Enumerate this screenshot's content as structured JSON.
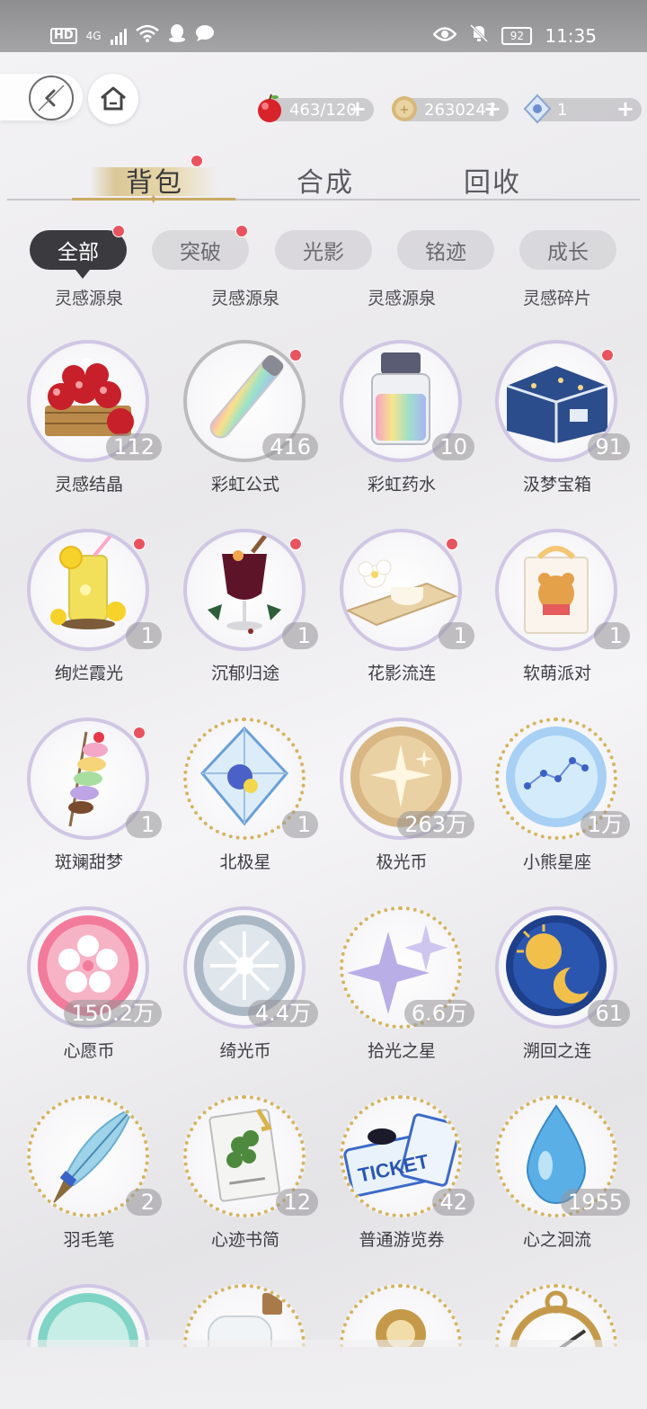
{
  "status": {
    "network": "4G",
    "battery": "92",
    "time": "11:35"
  },
  "resources": [
    {
      "icon": "apple-icon",
      "value": "463/120"
    },
    {
      "icon": "gold-coin-icon",
      "value": "2630247"
    },
    {
      "icon": "diamond-icon",
      "value": "1"
    }
  ],
  "main_tabs": [
    "背包",
    "合成",
    "回收"
  ],
  "sub_tabs": [
    "全部",
    "突破",
    "光影",
    "铭迹",
    "成长"
  ],
  "captions": [
    "灵感源泉",
    "灵感源泉",
    "灵感源泉",
    "灵感碎片"
  ],
  "items": [
    {
      "name": "灵感结晶",
      "count": "112",
      "icon": "apple-basket-icon",
      "ring": "lavender",
      "dot": false
    },
    {
      "name": "彩虹公式",
      "count": "416",
      "icon": "rainbow-tube-icon",
      "ring": "grey",
      "dot": true
    },
    {
      "name": "彩虹药水",
      "count": "10",
      "icon": "rainbow-potion-icon",
      "ring": "lavender",
      "dot": false
    },
    {
      "name": "汲梦宝箱",
      "count": "91",
      "icon": "treasure-box-icon",
      "ring": "lavender",
      "dot": true
    },
    {
      "name": "绚烂霞光",
      "count": "1",
      "icon": "lemonade-icon",
      "ring": "lavender",
      "dot": true
    },
    {
      "name": "沉郁归途",
      "count": "1",
      "icon": "mulled-wine-icon",
      "ring": "lavender",
      "dot": true
    },
    {
      "name": "花影流连",
      "count": "1",
      "icon": "flower-cake-icon",
      "ring": "lavender",
      "dot": true
    },
    {
      "name": "软萌派对",
      "count": "1",
      "icon": "teddy-bag-icon",
      "ring": "lavender",
      "dot": false
    },
    {
      "name": "斑斓甜梦",
      "count": "1",
      "icon": "macaron-skewer-icon",
      "ring": "lavender",
      "dot": true
    },
    {
      "name": "北极星",
      "count": "1",
      "icon": "crystal-icon",
      "ring": "gold",
      "dot": false
    },
    {
      "name": "极光币",
      "count": "263万",
      "icon": "aurora-coin-icon",
      "ring": "lavender",
      "dot": false
    },
    {
      "name": "小熊星座",
      "count": "1万",
      "icon": "constellation-coin-icon",
      "ring": "gold",
      "dot": false
    },
    {
      "name": "心愿币",
      "count": "150.2万",
      "icon": "sakura-coin-icon",
      "ring": "lavender",
      "dot": false
    },
    {
      "name": "绮光币",
      "count": "4.4万",
      "icon": "silver-coin-icon",
      "ring": "lavender",
      "dot": false
    },
    {
      "name": "拾光之星",
      "count": "6.6万",
      "icon": "sparkle-star-icon",
      "ring": "gold",
      "dot": false
    },
    {
      "name": "溯回之连",
      "count": "61",
      "icon": "sun-moon-coin-icon",
      "ring": "lavender",
      "dot": false
    },
    {
      "name": "羽毛笔",
      "count": "2",
      "icon": "quill-pen-icon",
      "ring": "gold",
      "dot": false
    },
    {
      "name": "心迹书简",
      "count": "12",
      "icon": "herb-card-icon",
      "ring": "gold",
      "dot": false
    },
    {
      "name": "普通游览券",
      "count": "42",
      "icon": "ticket-icon",
      "ring": "gold",
      "dot": false
    },
    {
      "name": "心之洄流",
      "count": "1955",
      "icon": "water-drop-icon",
      "ring": "gold",
      "dot": false
    }
  ],
  "partial_row": [
    "mint-coin-icon",
    "glass-bottle-icon",
    "ornament-icon",
    "compass-icon"
  ],
  "colors": {
    "accent_red": "#e8535f",
    "ring_lavender": "#cfc7e4",
    "ring_gold": "#d4b55e",
    "active_tab": "#3b3a3e"
  }
}
